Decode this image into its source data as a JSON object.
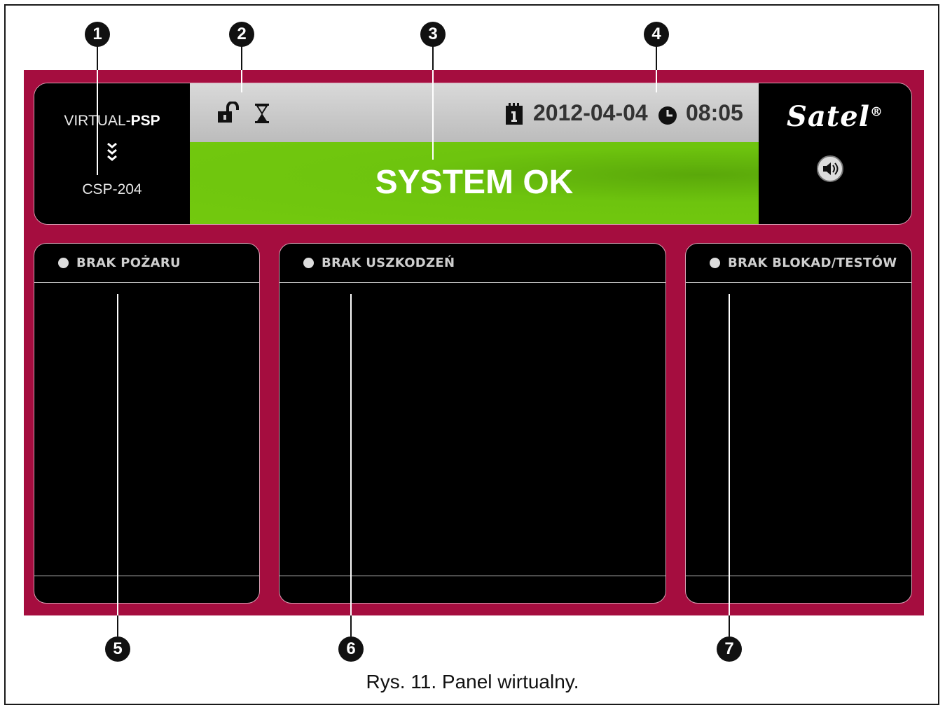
{
  "header": {
    "model_prefix": "VIRTUAL-",
    "model_suffix": "PSP",
    "chevrons": "⌄\n⌄\n⌄",
    "board": "CSP-204",
    "date": "2012-04-04",
    "time": "08:05",
    "status": "SYSTEM OK",
    "logo": "Satel",
    "logo_mark": "®"
  },
  "boxes": {
    "fire": {
      "title": "BRAK POŻARU"
    },
    "faults": {
      "title": "BRAK USZKODZEŃ"
    },
    "blocks": {
      "title": "BRAK BLOKAD/TESTÓW"
    }
  },
  "callouts": [
    "1",
    "2",
    "3",
    "4",
    "5",
    "6",
    "7"
  ],
  "caption": "Rys. 11. Panel wirtualny.",
  "colors": {
    "panel": "#a50d3f",
    "status_ok": "#6ec40e",
    "bar": "#cccccc"
  },
  "icons": [
    "lock-open-icon",
    "hourglass-icon",
    "calendar-icon",
    "clock-icon",
    "speaker-icon"
  ]
}
